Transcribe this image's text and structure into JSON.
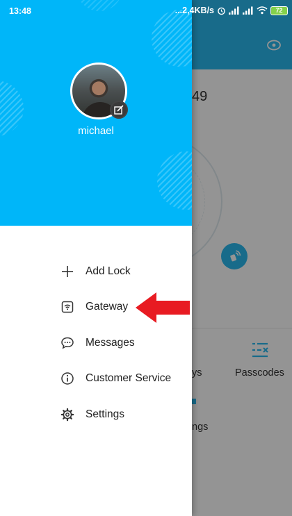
{
  "status_bar": {
    "time": "13:48",
    "network_speed": "...2,4KB/s",
    "battery_level": "72"
  },
  "background_screen": {
    "lock_name_partial": "49",
    "menu_labels": [
      "ys",
      "Passcodes",
      "ngs"
    ]
  },
  "drawer": {
    "header_color": "#00b6f9",
    "username": "michael",
    "items": [
      {
        "label": "Add Lock",
        "icon": "plus-icon"
      },
      {
        "label": "Gateway",
        "icon": "gateway-icon"
      },
      {
        "label": "Messages",
        "icon": "messages-icon"
      },
      {
        "label": "Customer Service",
        "icon": "info-icon"
      },
      {
        "label": "Settings",
        "icon": "gear-icon"
      }
    ]
  },
  "annotation": {
    "arrow_color": "#e81b22",
    "points_to": "Gateway"
  }
}
